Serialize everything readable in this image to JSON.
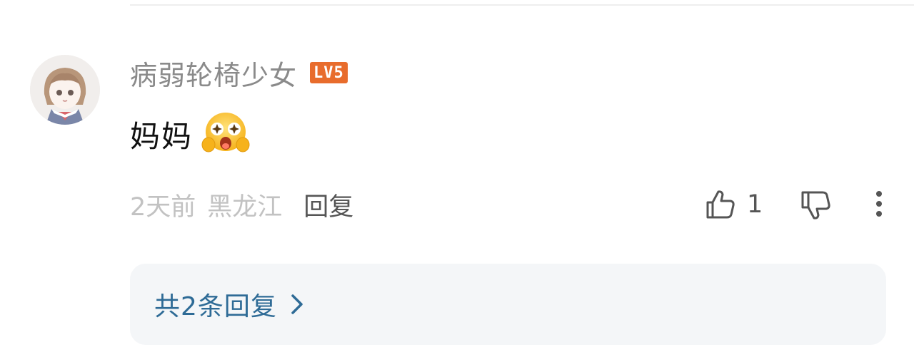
{
  "comment": {
    "username": "病弱轮椅少女",
    "level": "LV5",
    "text": "妈妈",
    "emoji": "starry-eyed-face-emoji",
    "time": "2天前",
    "location": "黑龙江",
    "reply_label": "回复",
    "likes": "1"
  },
  "replies": {
    "summary": "共2条回复"
  },
  "colors": {
    "username": "#8a8a8a",
    "level_badge": "#e86c2c",
    "meta": "#c2c2c2",
    "reply_link": "#2e6b96",
    "reply_box_bg": "#f4f6f8"
  },
  "icons": {
    "like": "thumbs-up-icon",
    "dislike": "thumbs-down-icon",
    "more": "more-vertical-icon",
    "chevron": "chevron-right-icon"
  }
}
